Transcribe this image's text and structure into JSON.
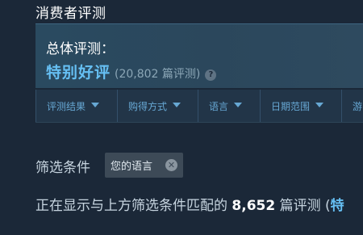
{
  "section_title": "消费者评测",
  "summary": {
    "label": "总体评测：",
    "rating": "特别好评",
    "count": "(20,802 篇评测)",
    "help_glyph": "?"
  },
  "filter_tabs": [
    {
      "label": "评测结果"
    },
    {
      "label": "购得方式"
    },
    {
      "label": "语言"
    },
    {
      "label": "日期范围"
    },
    {
      "label": "游"
    }
  ],
  "filters": {
    "label": "筛选条件",
    "chip_label": "您的语言",
    "chip_close_glyph": "✕"
  },
  "result": {
    "prefix": "正在显示与上方筛选条件匹配的 ",
    "count": "8,652",
    "suffix": " 篇评测 (",
    "trailing": "特"
  },
  "colors": {
    "background": "#1b2838",
    "accent": "#66c0f4",
    "tab_text": "#67a8d4"
  }
}
